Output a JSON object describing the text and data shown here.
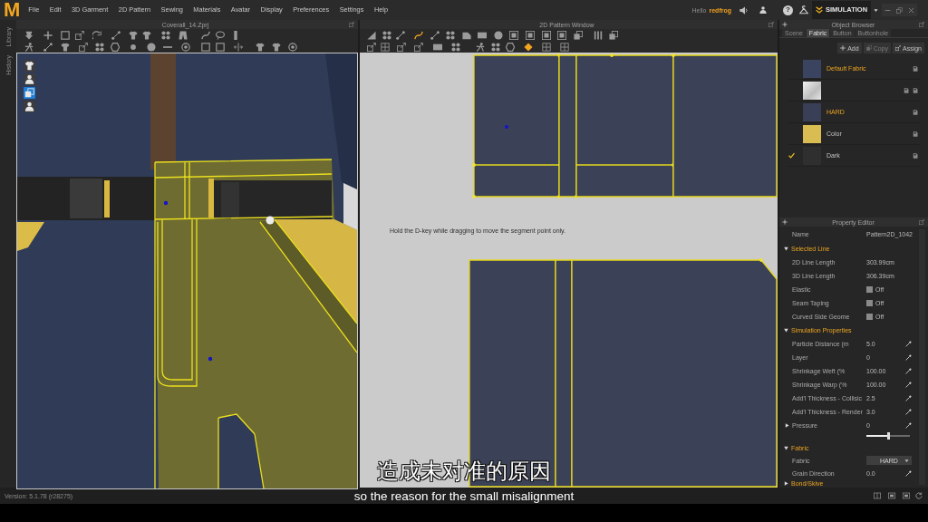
{
  "menu_bar": {
    "logo": "M",
    "menus": [
      "File",
      "Edit",
      "3D Garment",
      "2D Pattern",
      "Sewing",
      "Materials",
      "Avatar",
      "Display",
      "Preferences",
      "Settings",
      "Help"
    ],
    "greeting": "Hello",
    "user": "redfrog",
    "help": "?",
    "mode": "SIMULATION"
  },
  "side_strip": {
    "tabs": [
      "Library",
      "History"
    ]
  },
  "window_3d": {
    "title": "Coverall_14.Zprj",
    "toolbar_rows": [
      [
        {
          "selected": false
        },
        {
          "selected": false
        },
        {
          "selected": false
        },
        {
          "selected": false
        },
        {
          "selected": false
        },
        {
          "selected": false
        },
        {
          "selected": false
        },
        {
          "selected": false
        },
        {
          "selected": false
        },
        {
          "selected": false
        },
        {
          "selected": false
        },
        {
          "selected": false
        },
        {
          "selected": false
        }
      ],
      [
        {
          "selected": false
        },
        {
          "selected": false
        },
        {
          "selected": false
        },
        {
          "selected": false
        },
        {
          "selected": false
        },
        {
          "selected": false
        },
        {
          "selected": false
        },
        {
          "selected": false
        },
        {
          "selected": false
        },
        {
          "selected": false
        },
        {
          "selected": false
        },
        {
          "selected": false
        },
        {
          "selected": false
        },
        {
          "selected": false
        },
        {
          "selected": false
        },
        {
          "selected": false
        }
      ]
    ],
    "view_toggles": [
      {
        "on": false
      },
      {
        "on": false
      },
      {
        "on": true
      },
      {
        "on": false
      }
    ]
  },
  "window_2d": {
    "title": "2D Pattern Window",
    "toolbar_rows": [
      [
        {
          "selected": false
        },
        {
          "selected": false
        },
        {
          "selected": false
        },
        {
          "selected": true
        },
        {
          "selected": false
        },
        {
          "selected": false
        },
        {
          "selected": false
        },
        {
          "selected": false
        },
        {
          "selected": false
        },
        {
          "selected": false
        },
        {
          "selected": false
        },
        {
          "selected": false
        },
        {
          "selected": false
        },
        {
          "selected": false
        },
        {
          "selected": false
        },
        {
          "selected": false
        }
      ],
      [
        {
          "selected": false
        },
        {
          "selected": false
        },
        {
          "selected": false
        },
        {
          "selected": false
        },
        {
          "selected": false
        },
        {
          "selected": false
        },
        {
          "selected": false
        },
        {
          "selected": false
        },
        {
          "selected": false
        },
        {
          "selected": true
        },
        {
          "selected": false
        },
        {
          "selected": false
        }
      ]
    ],
    "hint": "Hold the D-key while dragging to move the segment point only."
  },
  "object_browser": {
    "title": "Object Browser",
    "tabs": [
      {
        "label": "Scene",
        "selected": false
      },
      {
        "label": "Fabric",
        "selected": true
      },
      {
        "label": "Button",
        "selected": false
      },
      {
        "label": "Buttonhole",
        "selected": false
      }
    ],
    "actions": [
      {
        "label": "Add",
        "disabled": false
      },
      {
        "label": "Copy",
        "disabled": true
      },
      {
        "label": "Assign",
        "disabled": false
      }
    ],
    "fabrics": [
      {
        "kind": "swatch",
        "name": "Default Fabric",
        "color": "#3a4461",
        "in_use": true,
        "checked": false
      },
      {
        "kind": "texture",
        "checked": false
      },
      {
        "kind": "swatch",
        "name": "HARD",
        "color": "#393f57",
        "in_use": true,
        "checked": false
      },
      {
        "kind": "swatch",
        "name": "Color",
        "color": "#d9bd52",
        "in_use": false,
        "checked": false
      },
      {
        "kind": "swatch",
        "name": "Dark",
        "color": "#2f2f2f",
        "in_use": false,
        "checked": true
      }
    ]
  },
  "property_editor": {
    "title": "Property Editor",
    "name": {
      "label": "Name",
      "value": "Pattern2D_1042"
    },
    "sections": [
      {
        "title": "Selected Line",
        "expanded": true,
        "rows": [
          {
            "kind": "text",
            "label": "2D Line Length",
            "value": "303.99cm"
          },
          {
            "kind": "text",
            "label": "3D Line Length",
            "value": "306.39cm"
          },
          {
            "kind": "toggle",
            "label": "Elastic",
            "value": "Off",
            "checked": false
          },
          {
            "kind": "toggle",
            "label": "Seam Taping",
            "value": "Off",
            "checked": false
          },
          {
            "kind": "toggle",
            "label": "Curved Side Geome",
            "value": "Off",
            "checked": false
          }
        ]
      },
      {
        "title": "Simulation Properties",
        "expanded": true,
        "rows": [
          {
            "kind": "number",
            "label": "Particle Distance (m",
            "value": "5.0"
          },
          {
            "kind": "number",
            "label": "Layer",
            "value": "0"
          },
          {
            "kind": "number",
            "label": "Shrinkage Weft (%",
            "value": "100.00"
          },
          {
            "kind": "number",
            "label": "Shrinkage Warp (%",
            "value": "100.00"
          },
          {
            "kind": "number",
            "label": "Add'l Thickness - Collisic",
            "value": "2.5"
          },
          {
            "kind": "number",
            "label": "Add'l Thickness - Render",
            "value": "3.0"
          },
          {
            "kind": "slider",
            "label": "Pressure",
            "value": "0",
            "expanded": false,
            "level": 0.5
          }
        ]
      },
      {
        "title": "Fabric",
        "expanded": true,
        "rows": [
          {
            "kind": "dropdown",
            "label": "Fabric",
            "value": "HARD"
          },
          {
            "kind": "number",
            "label": "Grain Direction",
            "value": "0.0"
          }
        ]
      },
      {
        "title": "Bond/Skive",
        "expanded": false
      }
    ]
  },
  "status_bar": {
    "version": "Version: 5.1.78 (r28275)"
  },
  "subtitles": {
    "zh": "造成未对准的原因",
    "en": "so the reason for the small misalignment"
  }
}
